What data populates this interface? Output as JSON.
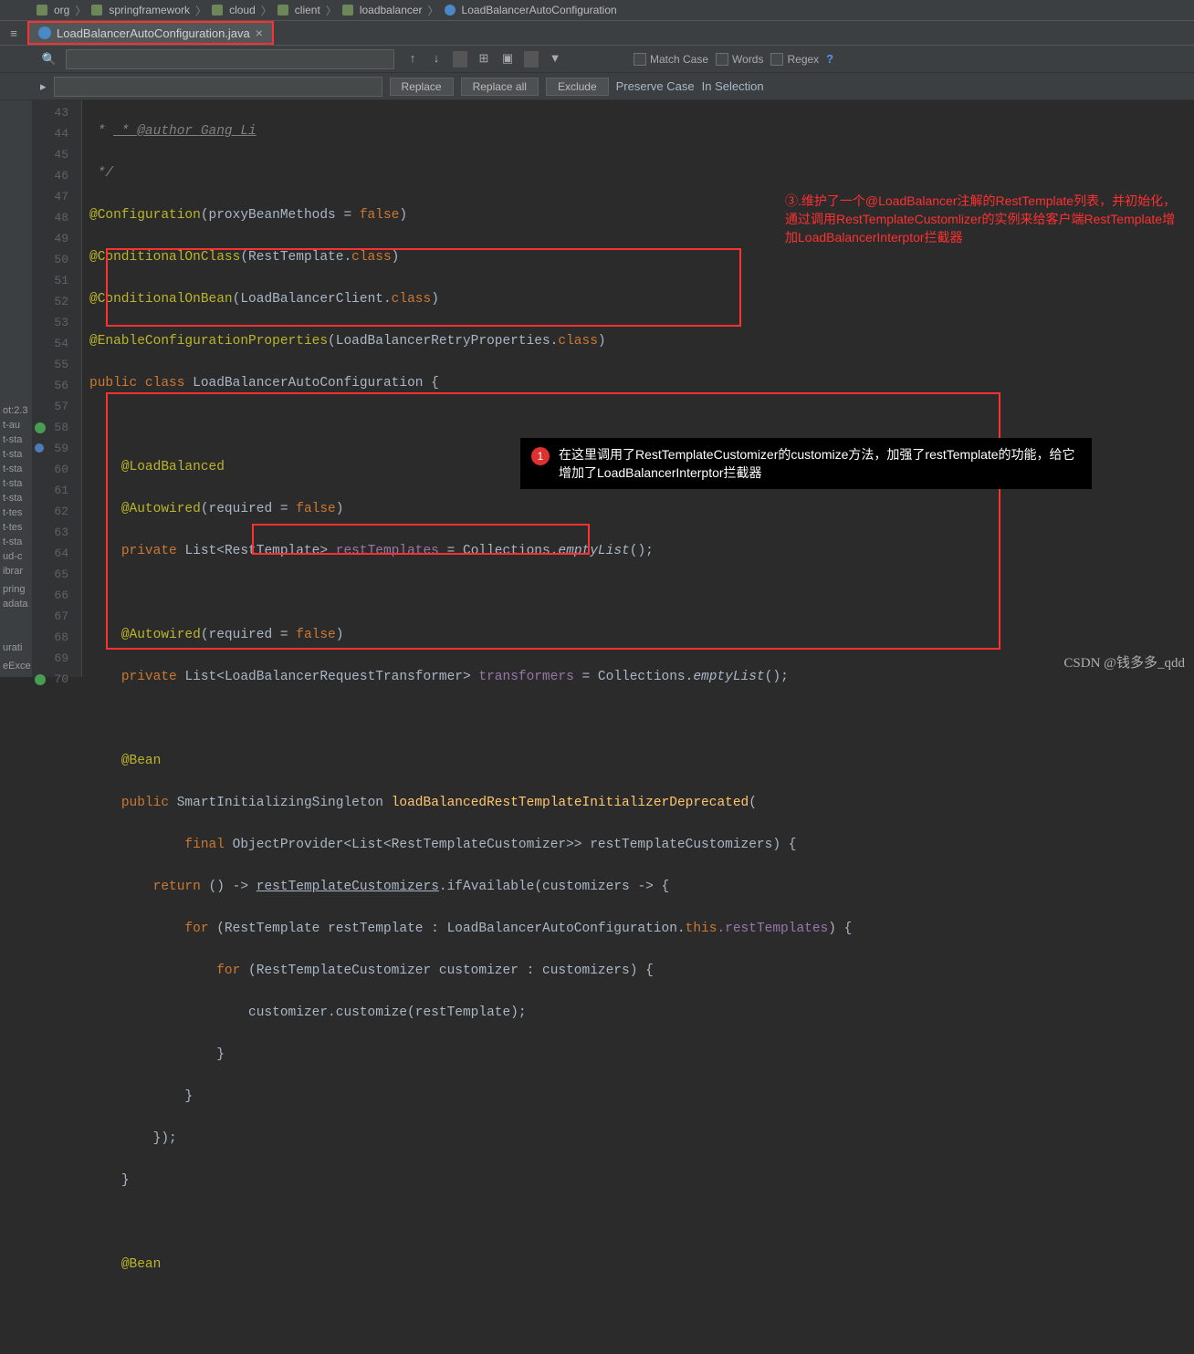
{
  "breadcrumb": {
    "items": [
      "org",
      "springframework",
      "cloud",
      "client",
      "loadbalancer",
      "LoadBalancerAutoConfiguration"
    ]
  },
  "tab": {
    "name": "LoadBalancerAutoConfiguration.java"
  },
  "search": {
    "placeholder": "",
    "match_case": "Match Case",
    "words": "Words",
    "regex": "Regex",
    "replace_btn": "Replace",
    "replace_all_btn": "Replace all",
    "exclude_btn": "Exclude",
    "preserve_case": "Preserve Case",
    "in_selection": "In Selection"
  },
  "sidebar": {
    "items": [
      "ot:2.3",
      "t-au",
      "t-sta",
      "t-sta",
      "t-sta",
      "t-sta",
      "t-sta",
      "t-tes",
      "t-tes",
      "t-sta",
      "ud-c",
      "ibrar",
      "",
      "pring",
      "adata",
      "",
      "",
      "",
      "",
      "",
      "",
      "",
      "",
      "urati",
      "",
      "eExce",
      ""
    ]
  },
  "lines": {
    "start": 43,
    "end": 70
  },
  "code": {
    "l43": " * @author Gang Li",
    "l44": " */",
    "l45_ann": "@Configuration",
    "l45_rest": "(proxyBeanMethods = ",
    "l45_false": "false",
    "l45_end": ")",
    "l46_ann": "@ConditionalOnClass",
    "l46_rest": "(RestTemplate.",
    "l46_kw": "class",
    "l46_end": ")",
    "l47_ann": "@ConditionalOnBean",
    "l47_rest": "(LoadBalancerClient.",
    "l47_kw": "class",
    "l47_end": ")",
    "l48_ann": "@EnableConfigurationProperties",
    "l48_rest": "(LoadBalancerRetryProperties.",
    "l48_kw": "class",
    "l48_end": ")",
    "l49_pub": "public class ",
    "l49_cls": "LoadBalancerAutoConfiguration ",
    "l49_brace": "{",
    "l51_ann": "@LoadBalanced",
    "l52_ann": "@Autowired",
    "l52_rest": "(required = ",
    "l52_false": "false",
    "l52_end": ")",
    "l53_priv": "private ",
    "l53_type": "List<RestTemplate> ",
    "l53_field": "restTemplates",
    "l53_eq": " = Collections.",
    "l53_call": "emptyList",
    "l53_end": "();",
    "l55_ann": "@Autowired",
    "l55_rest": "(required = ",
    "l55_false": "false",
    "l55_end": ")",
    "l56_priv": "private ",
    "l56_type": "List<LoadBalancerRequestTransformer> ",
    "l56_field": "transformers",
    "l56_eq": " = Collections.",
    "l56_call": "emptyList",
    "l56_end": "();",
    "l58_ann": "@Bean",
    "l59_pub": "public ",
    "l59_type": "SmartInitializingSingleton ",
    "l59_method": "loadBalancedRestTemplateInitializerDeprecated",
    "l59_end": "(",
    "l60_final": "final ",
    "l60_type": "ObjectProvider<List<RestTemplateCustomizer>> restTemplateCustomizers) {",
    "l61_ret": "return ",
    "l61_lam": "() -> ",
    "l61_call": "restTemplateCustomizers",
    "l61_rest": ".ifAvailable(customizers -> {",
    "l62_for": "for ",
    "l62_rest": "(RestTemplate restTemplate : LoadBalancerAutoConfiguration.",
    "l62_this": "this",
    "l62_field": ".restTemplates",
    "l62_end": ") {",
    "l63_for": "for ",
    "l63_rest": "(RestTemplateCustomizer customizer : customizers) {",
    "l64": "customizer.customize(restTemplate);",
    "l65": "}",
    "l66": "}",
    "l67": "});",
    "l68": "}",
    "l70_ann": "@Bean"
  },
  "annotation3": "③.维护了一个@LoadBalancer注解的RestTemplate列表，并初始化，通过调用RestTemplateCustomlizer的实例来给客户端RestTemplate增加LoadBalancerInterptor拦截器",
  "tooltip": {
    "num": "1",
    "text": "在这里调用了RestTemplateCustomizer的customize方法，加强了restTemplate的功能，给它增加了LoadBalancerInterptor拦截器"
  },
  "watermark": "CSDN @钱多多_qdd"
}
